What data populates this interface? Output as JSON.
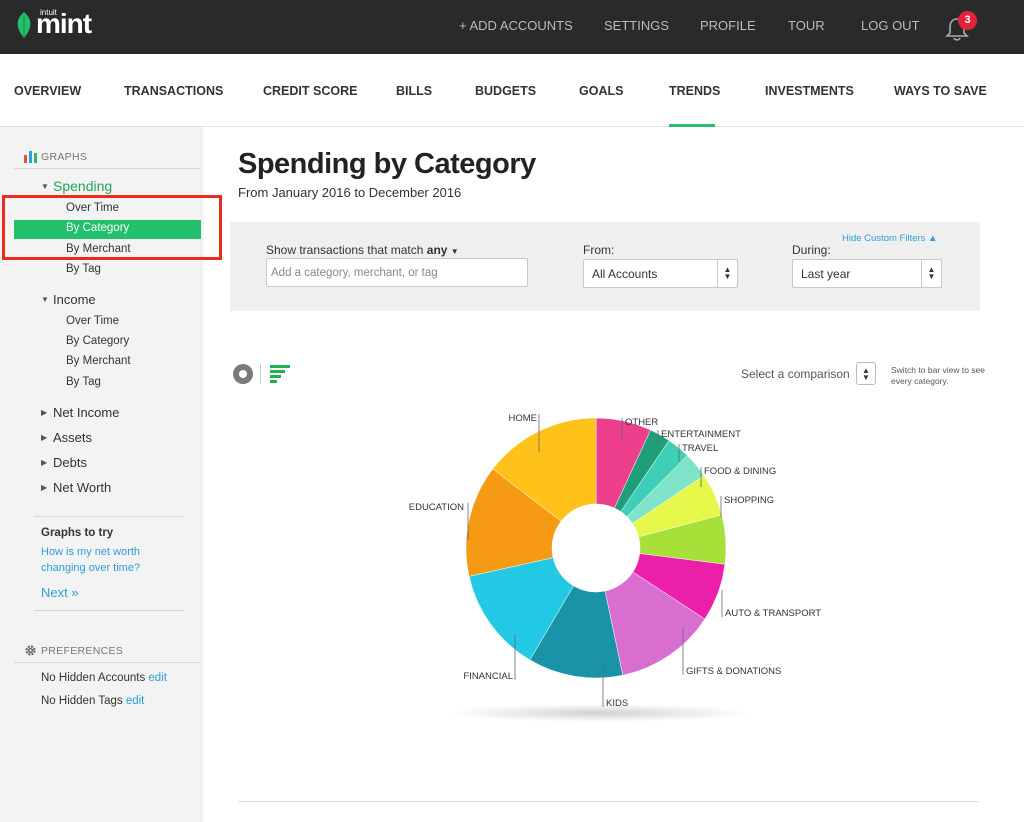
{
  "brand": {
    "intuit": "intuit",
    "name": "mint"
  },
  "topnav": {
    "items": [
      "+ ADD ACCOUNTS",
      "SETTINGS",
      "PROFILE",
      "TOUR",
      "LOG OUT"
    ],
    "notifications": "3"
  },
  "mainnav": {
    "items": [
      "OVERVIEW",
      "TRANSACTIONS",
      "CREDIT SCORE",
      "BILLS",
      "BUDGETS",
      "GOALS",
      "TRENDS",
      "INVESTMENTS",
      "WAYS TO SAVE"
    ],
    "active": "TRENDS"
  },
  "sidebar": {
    "graphs_title": "GRAPHS",
    "spending": {
      "label": "Spending",
      "items": [
        "Over Time",
        "By Category",
        "By Merchant",
        "By Tag"
      ],
      "selected": "By Category"
    },
    "income": {
      "label": "Income",
      "items": [
        "Over Time",
        "By Category",
        "By Merchant",
        "By Tag"
      ]
    },
    "groups": [
      "Net Income",
      "Assets",
      "Debts",
      "Net Worth"
    ],
    "graphs_to_try": {
      "title": "Graphs to try",
      "line1": "How is my net worth",
      "line2": "changing over time?",
      "next": "Next »"
    },
    "preferences": {
      "title": "PREFERENCES",
      "row1": "No Hidden Accounts",
      "row2": "No Hidden Tags",
      "edit": "edit"
    }
  },
  "page": {
    "title": "Spending by Category",
    "subtitle": "From January 2016 to December 2016"
  },
  "filters": {
    "match_label": "Show transactions that match",
    "match_value": "any",
    "search_placeholder": "Add a category, merchant, or tag",
    "from_label": "From:",
    "from_value": "All Accounts",
    "during_label": "During:",
    "during_value": "Last year",
    "hide_link": "Hide Custom Filters"
  },
  "chart_controls": {
    "compare_label": "Select a comparison",
    "switch_note": "Switch to bar view to see every category."
  },
  "chart_data": {
    "type": "pie",
    "title": "Spending by Category",
    "slices": [
      {
        "label": "OTHER",
        "value": 6.9,
        "color": "#ee3f8c"
      },
      {
        "label": "ENTERTAINMENT",
        "value": 2.6,
        "color": "#1f9e7a"
      },
      {
        "label": "TRAVEL",
        "value": 2.9,
        "color": "#3fcfb8"
      },
      {
        "label": "FOOD & DINING",
        "value": 3.2,
        "color": "#7fe3c7"
      },
      {
        "label": "SHOPPING",
        "value": 5.3,
        "color": "#e6f74a"
      },
      {
        "label": "",
        "value": 6.1,
        "color": "#a8e03a"
      },
      {
        "label": "AUTO & TRANSPORT",
        "value": 7.2,
        "color": "#ec1faa"
      },
      {
        "label": "GIFTS & DONATIONS",
        "value": 12.5,
        "color": "#d86fd0"
      },
      {
        "label": "KIDS",
        "value": 11.8,
        "color": "#1a93a8"
      },
      {
        "label": "FINANCIAL",
        "value": 13.0,
        "color": "#22c8e4"
      },
      {
        "label": "EDUCATION",
        "value": 13.9,
        "color": "#f59a12"
      },
      {
        "label": "HOME",
        "value": 14.6,
        "color": "#ffc21a"
      }
    ]
  }
}
